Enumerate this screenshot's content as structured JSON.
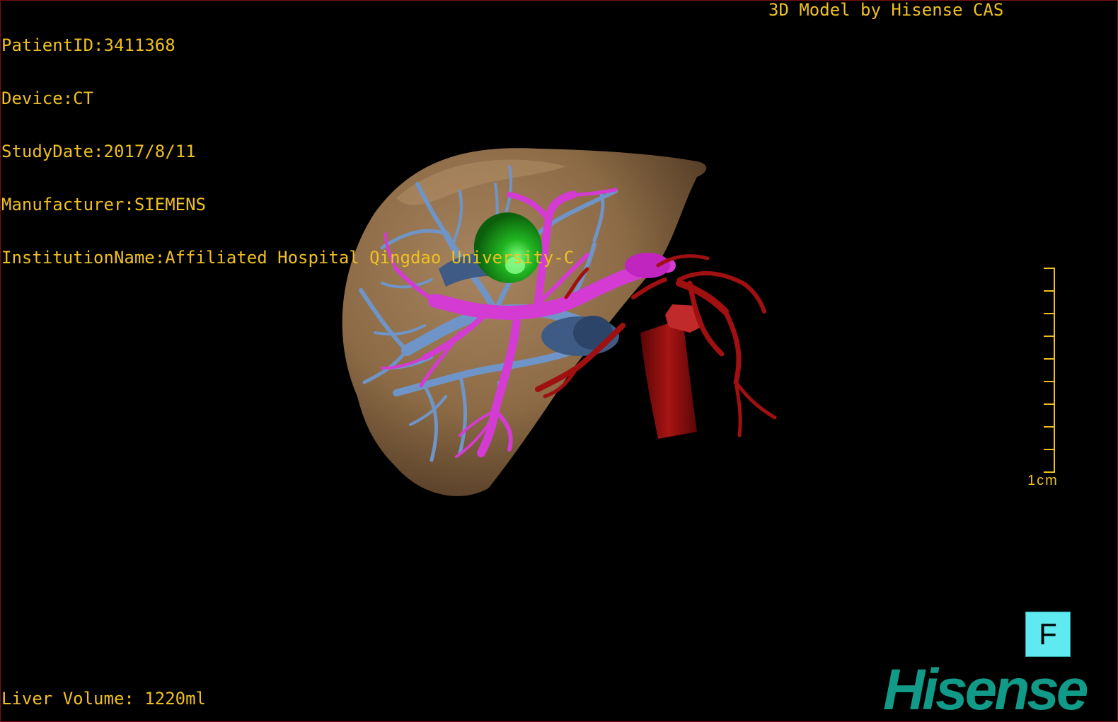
{
  "overlay": {
    "patient_id": "PatientID:3411368",
    "device": "Device:CT",
    "study_date": "StudyDate:2017/8/11",
    "manufacturer": "Manufacturer:SIEMENS",
    "institution": "InstitutionName:Affiliated Hospital Qingdao University-C",
    "model_credit": "3D Model by Hisense CAS",
    "liver_volume": "Liver Volume: 1220ml"
  },
  "scale": {
    "label": "1cm",
    "color": "#f0c020"
  },
  "orientation": {
    "face_label": "F",
    "color": "#5fe9f0"
  },
  "brand": {
    "logo_text": "Hisense",
    "color": "#129a88"
  },
  "render_colors": {
    "liver": "#8b6a45",
    "hepatic_vein": "#6f95c8",
    "portal_vein": "#d33bd3",
    "tumor": "#1e9a1e",
    "artery": "#a01010"
  }
}
